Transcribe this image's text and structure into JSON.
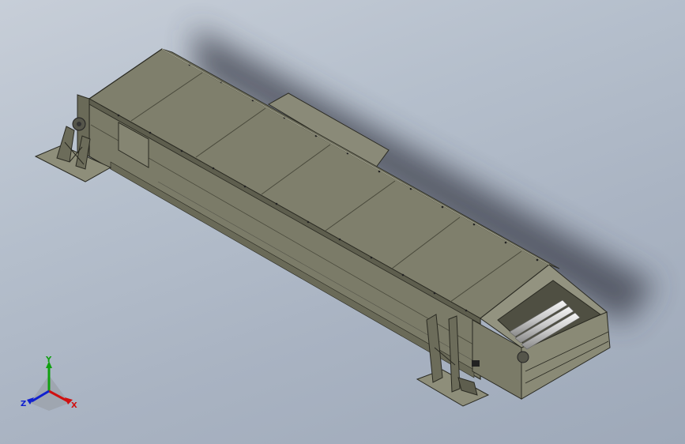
{
  "viewport": {
    "model": "belt-conveyor",
    "colors": {
      "background_top": "#c7ced8",
      "background_bottom": "#9ea9b9",
      "body": "#7b7b68",
      "body_light": "#8e8e7a",
      "body_dark": "#5e5e4e",
      "edge": "#2a2a22",
      "shadow": "#3a3e48"
    }
  },
  "triad": {
    "x_label": "X",
    "y_label": "Y",
    "z_label": "Z",
    "x_color": "#d01010",
    "y_color": "#10a010",
    "z_color": "#1020d0"
  }
}
